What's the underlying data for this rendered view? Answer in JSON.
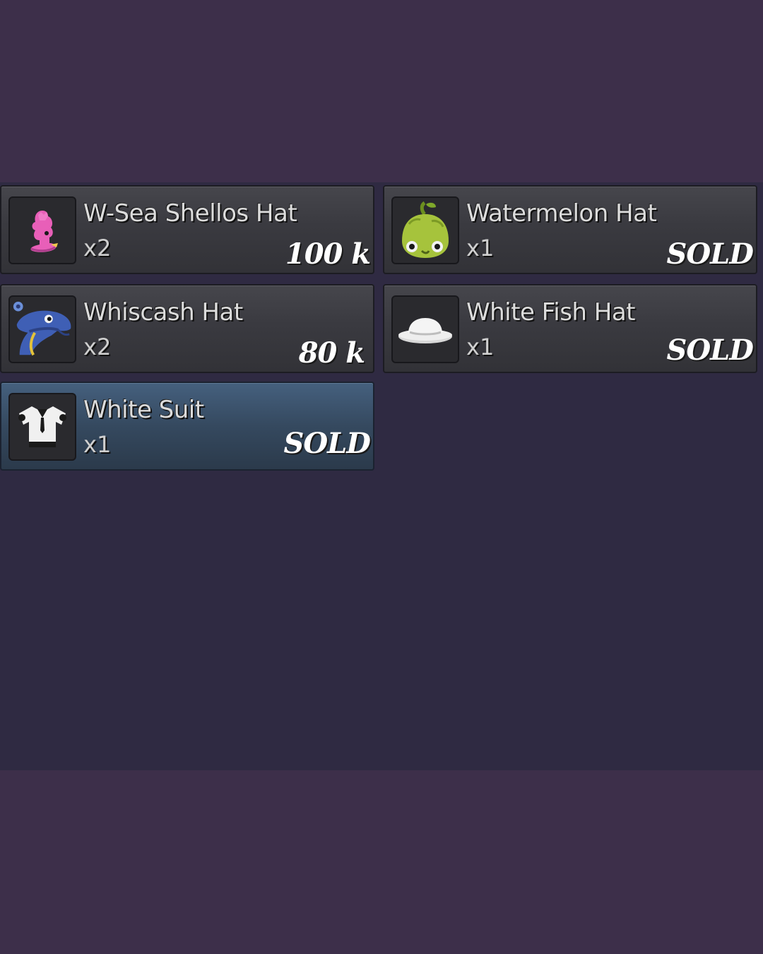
{
  "items": [
    {
      "name": "W-Sea Shellos Hat",
      "qty": "x2",
      "price": "100 k",
      "icon": "pink-shellos-hat-icon",
      "selected": false
    },
    {
      "name": "Watermelon Hat",
      "qty": "x1",
      "price": "SOLD",
      "icon": "watermelon-hat-icon",
      "selected": false
    },
    {
      "name": "Whiscash Hat",
      "qty": "x2",
      "price": "80 k",
      "icon": "whiscash-hat-icon",
      "selected": false
    },
    {
      "name": "White Fish Hat",
      "qty": "x1",
      "price": "SOLD",
      "icon": "white-fish-hat-icon",
      "selected": false
    },
    {
      "name": "White Suit",
      "qty": "x1",
      "price": "SOLD",
      "icon": "white-suit-icon",
      "selected": true
    }
  ],
  "colors": {
    "background": "#3d2f4a",
    "panel": "#2f2a42",
    "slot": "#3a3a40",
    "selected_slot": "#35495f"
  }
}
